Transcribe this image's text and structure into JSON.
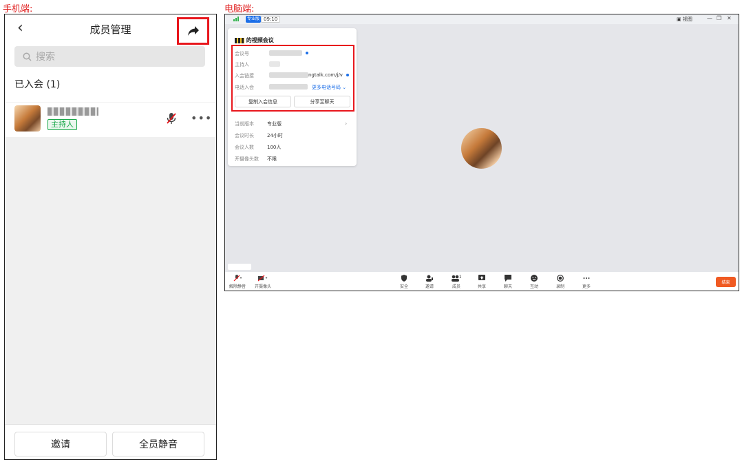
{
  "captions": {
    "mobile": "手机端:",
    "desktop": "电脑端:"
  },
  "mobile": {
    "title": "成员管理",
    "search_placeholder": "搜索",
    "section_label": "已入会 (1)",
    "member": {
      "role_badge": "主持人"
    },
    "footer": {
      "invite_label": "邀请",
      "mute_all_label": "全员静音"
    },
    "icons": [
      "back-icon",
      "share-arrow-icon",
      "search-icon",
      "mic-off-icon",
      "more-icon"
    ]
  },
  "desktop": {
    "topbar": {
      "edition_badge": "专业版",
      "time": "09:10",
      "view_label": "视图"
    },
    "info_panel": {
      "title": "的视频会议",
      "rows": {
        "meeting_id": "会议号",
        "host": "主持人",
        "join_link": "入会链接",
        "link_suffix": "ngtalk.com/j/v",
        "phone_join": "电话入会",
        "more_phones": "更多电话号码"
      },
      "buttons": {
        "copy": "复制入会信息",
        "share_chat": "分享至聊天"
      },
      "details": [
        {
          "label": "当前版本",
          "value": "专业版"
        },
        {
          "label": "会议时长",
          "value": "24小时"
        },
        {
          "label": "会议人数",
          "value": "100人"
        },
        {
          "label": "开摄像头数",
          "value": "不限"
        }
      ]
    },
    "toolbar": {
      "left": [
        {
          "label": "解除静音",
          "icon": "mic-off-icon"
        },
        {
          "label": "开摄像头",
          "icon": "camera-off-icon"
        }
      ],
      "center": [
        {
          "label": "安全",
          "icon": "shield-icon"
        },
        {
          "label": "邀请",
          "icon": "invite-icon"
        },
        {
          "label": "成员",
          "icon": "members-icon",
          "count": "1"
        },
        {
          "label": "共享",
          "icon": "share-screen-icon"
        },
        {
          "label": "聊天",
          "icon": "chat-icon"
        },
        {
          "label": "互动",
          "icon": "emoji-icon"
        },
        {
          "label": "录制",
          "icon": "record-icon"
        },
        {
          "label": "更多",
          "icon": "more-icon"
        }
      ],
      "end_label": "结束"
    },
    "colors": {
      "accent": "#1d6fe8",
      "end_button": "#f05a22",
      "highlight_box": "#e8161c"
    }
  }
}
